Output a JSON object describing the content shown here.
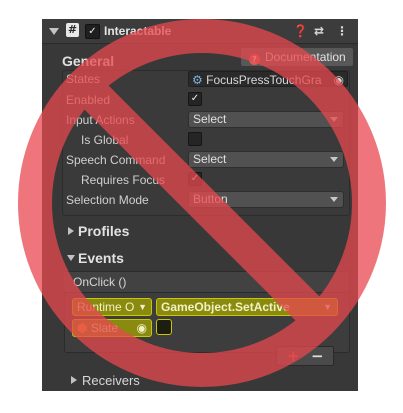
{
  "component": {
    "title": "Interactable",
    "enabled_checkbox": "✓",
    "script_icon": "#",
    "header_icons": [
      "help-icon",
      "presets-icon",
      "more-icon"
    ]
  },
  "documentation": {
    "label": "Documentation"
  },
  "general": {
    "heading": "General",
    "rows": [
      {
        "label": "States",
        "value": "FocusPressTouchGra"
      },
      {
        "label": "Enabled",
        "checked": true
      },
      {
        "label": "Input Actions",
        "value": "Select"
      },
      {
        "label": "Is Global",
        "checked": false
      },
      {
        "label": "Speech Command",
        "value": "Select"
      },
      {
        "label": "Requires Focus",
        "checked": true
      },
      {
        "label": "Selection Mode",
        "value": "Button"
      }
    ]
  },
  "profiles": {
    "label": "Profiles"
  },
  "events": {
    "label": "Events",
    "onclick": "OnClick ()",
    "runtime": "Runtime O",
    "function": "GameObject.SetActive",
    "target": "Slate",
    "plus": "+",
    "minus": "−"
  },
  "receivers": {
    "label": "Receivers"
  },
  "overlay": {
    "color": "#e7484f",
    "meaning": "prohibition-sign"
  },
  "colors": {
    "highlight": "#c8c800",
    "accent": "#3b8ddd"
  }
}
